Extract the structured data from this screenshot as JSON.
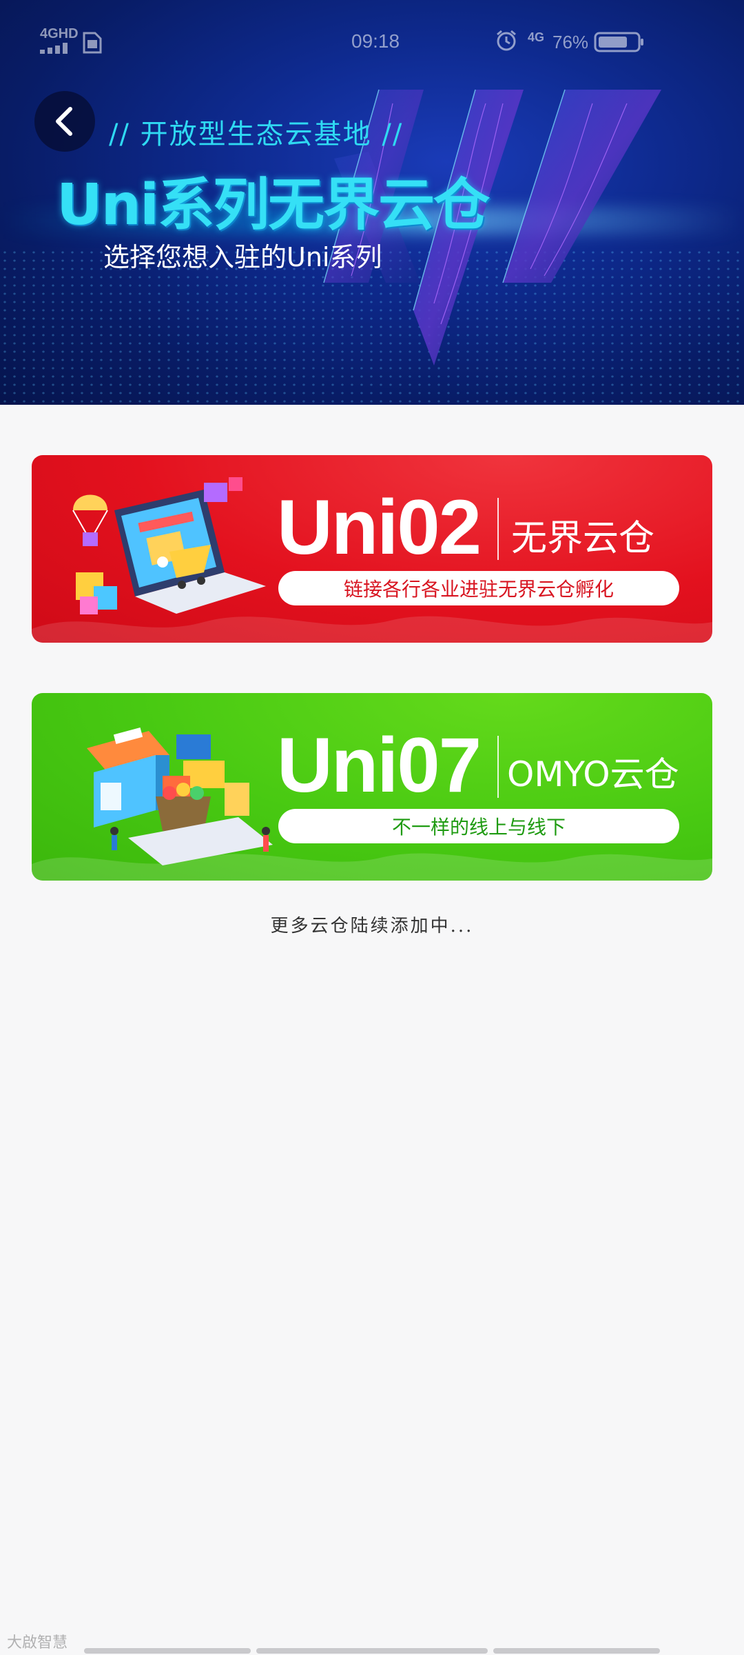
{
  "status_bar": {
    "network_type": "4GHD",
    "time": "09:18",
    "mobile_data": "4G",
    "battery_percent": "76%",
    "battery_level": 0.76
  },
  "hero": {
    "slogan": "// 开放型生态云基地 //",
    "title": "Uni系列无界云仓",
    "subtitle": "选择您想入驻的Uni系列"
  },
  "cards": [
    {
      "code": "Uni02",
      "tagline": "无界云仓",
      "pill_text": "链接各行各业进驻无界云仓孵化",
      "accent": "#e3111e"
    },
    {
      "code": "Uni07",
      "tagline": "OMYO云仓",
      "pill_text": "不一样的线上与线下",
      "accent": "#48c912"
    }
  ],
  "footer_note": "更多云仓陆续添加中...",
  "watermark": "大啟智慧",
  "icons": {
    "back": "chevron-left-icon",
    "sim": "sim-card-icon",
    "alarm": "alarm-clock-icon",
    "battery": "battery-icon"
  }
}
